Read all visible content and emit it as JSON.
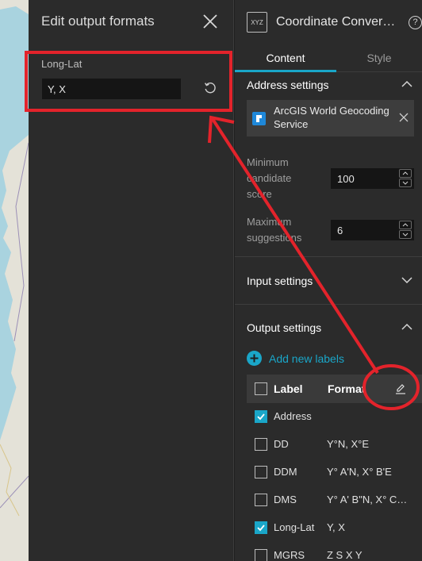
{
  "edit_panel": {
    "title": "Edit output formats",
    "row_label": "Long-Lat",
    "input_value": "Y, X"
  },
  "header": {
    "widget_icon_text": "XYZ",
    "title": "Coordinate Conver…",
    "help": "?"
  },
  "tabs": {
    "content": "Content",
    "style": "Style"
  },
  "address_settings": {
    "title": "Address settings",
    "geocoder_name": "ArcGIS World Geocoding Service",
    "min_score_label": "Minimum candidate score",
    "min_score_value": "100",
    "max_suggestions_label": "Maximum suggestions",
    "max_suggestions_value": "6"
  },
  "input_settings": {
    "title": "Input settings"
  },
  "output_settings": {
    "title": "Output settings",
    "add_label": "Add new labels",
    "col_label": "Label",
    "col_format": "Format",
    "rows": [
      {
        "label": "Address",
        "format": "",
        "checked": true
      },
      {
        "label": "DD",
        "format": "Y°N, X°E",
        "checked": false
      },
      {
        "label": "DDM",
        "format": "Y° A'N, X° B'E",
        "checked": false
      },
      {
        "label": "DMS",
        "format": "Y° A' B\"N, X° C…",
        "checked": false
      },
      {
        "label": "Long-Lat",
        "format": "Y, X",
        "checked": true
      },
      {
        "label": "MGRS",
        "format": "Z S X Y",
        "checked": false
      }
    ]
  },
  "colors": {
    "accent": "#1aa6c8",
    "annotation": "#e3232b"
  }
}
